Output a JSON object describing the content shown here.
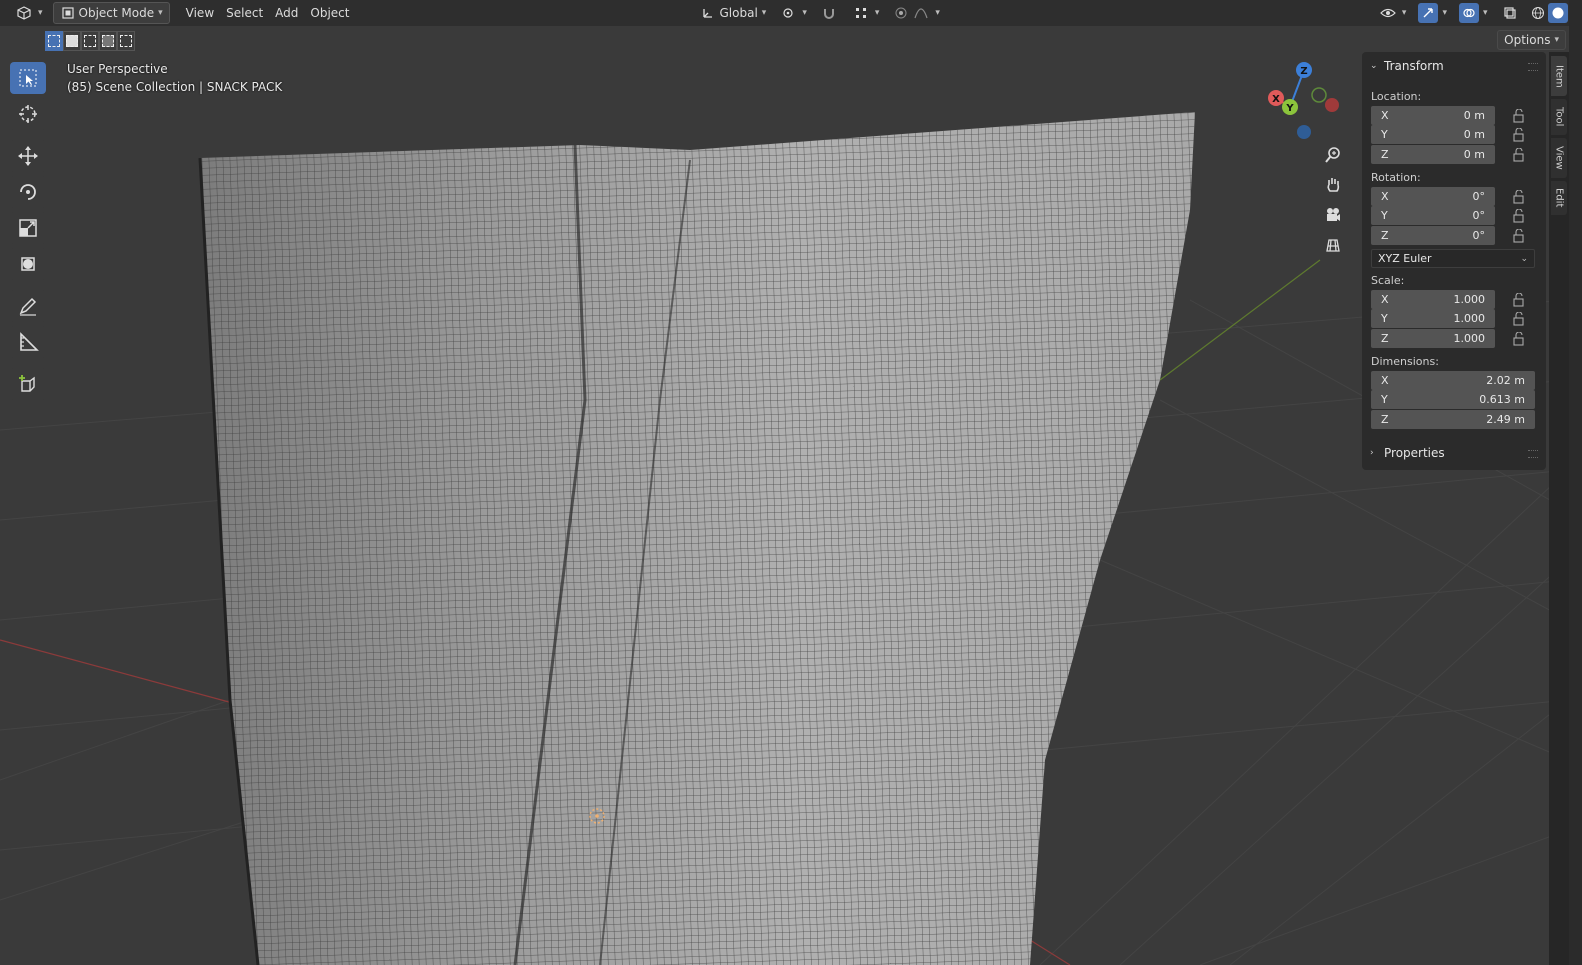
{
  "header": {
    "editor_icon": "view3d-icon",
    "mode_label": "Object Mode",
    "menus": [
      "View",
      "Select",
      "Add",
      "Object"
    ],
    "orientation_label": "Global",
    "options_label": "Options"
  },
  "overlay": {
    "view_name": "User Perspective",
    "collection": "(85) Scene Collection | SNACK PACK"
  },
  "gizmo": {
    "z": "Z",
    "y": "Y",
    "x": "X"
  },
  "npanel": {
    "transform_title": "Transform",
    "location_label": "Location:",
    "location": [
      {
        "axis": "X",
        "value": "0 m"
      },
      {
        "axis": "Y",
        "value": "0 m"
      },
      {
        "axis": "Z",
        "value": "0 m"
      }
    ],
    "rotation_label": "Rotation:",
    "rotation": [
      {
        "axis": "X",
        "value": "0°"
      },
      {
        "axis": "Y",
        "value": "0°"
      },
      {
        "axis": "Z",
        "value": "0°"
      }
    ],
    "rotation_mode": "XYZ Euler",
    "scale_label": "Scale:",
    "scale": [
      {
        "axis": "X",
        "value": "1.000"
      },
      {
        "axis": "Y",
        "value": "1.000"
      },
      {
        "axis": "Z",
        "value": "1.000"
      }
    ],
    "dimensions_label": "Dimensions:",
    "dimensions": [
      {
        "axis": "X",
        "value": "2.02 m"
      },
      {
        "axis": "Y",
        "value": "0.613 m"
      },
      {
        "axis": "Z",
        "value": "2.49 m"
      }
    ],
    "properties_title": "Properties"
  },
  "sidetabs": [
    "Item",
    "Tool",
    "View",
    "Edit"
  ],
  "colors": {
    "accent": "#4772b3",
    "axis_x": "#e05a5a",
    "axis_y": "#8cc43c",
    "axis_z": "#3c7fd8"
  }
}
